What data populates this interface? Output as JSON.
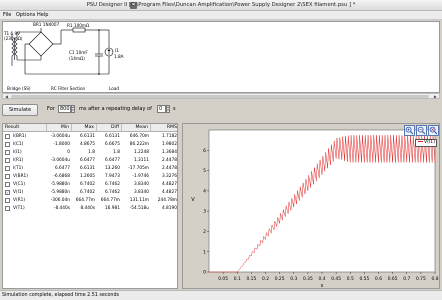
{
  "window": {
    "title": "PSU Designer II  [C:\\Program Files\\Duncan Amplification\\Power Supply Designer 2\\SEX filament.psu ]  *",
    "app_icon": "psud-app-icon"
  },
  "menu": {
    "items": [
      "File",
      "Options",
      "Help"
    ]
  },
  "schematic": {
    "labels": {
      "br": "BR1 1N4007",
      "t1": "T1 6.9V",
      "t1_r": "(230mΩ)",
      "r1": "R1 100mΩ",
      "c1": "C1 10mF",
      "c1_esr": "(14mΩ)",
      "i1": "I1",
      "i1_val": "1.8A",
      "bridge": "Bridge (SS)",
      "rc": "RC Filter Section",
      "load": "Load"
    }
  },
  "controls": {
    "simulate_label": "Simulate",
    "for_label": "For",
    "duration": "800",
    "ms_label": "ms  after a repeating delay of",
    "delay": "0",
    "s_label": "s"
  },
  "results": {
    "headers": [
      "Result",
      "Min",
      "Max",
      "Diff",
      "Mean",
      "RMS"
    ],
    "rows": [
      {
        "checked": false,
        "name": "I(BR1)",
        "min": "-3.0604u",
        "max": "6.6131",
        "diff": "6.6131",
        "mean": "646.70m",
        "rms": "1.7182"
      },
      {
        "checked": false,
        "name": "I(C1)",
        "min": "-1.8000",
        "max": "4.8675",
        "diff": "6.6675",
        "mean": "86.222m",
        "rms": "1.9802"
      },
      {
        "checked": false,
        "name": "I(I1)",
        "min": "0",
        "max": "1.8",
        "diff": "1.8",
        "mean": "1.2248",
        "rms": "1.3684"
      },
      {
        "checked": false,
        "name": "I(R1)",
        "min": "-3.0604u",
        "max": "6.6477",
        "diff": "6.6477",
        "mean": "1.3111",
        "rms": "2.4478"
      },
      {
        "checked": false,
        "name": "I(T1)",
        "min": "6.6477",
        "max": "6.6131",
        "diff": "13.260",
        "mean": "-17.705m",
        "rms": "2.4478"
      },
      {
        "checked": false,
        "name": "V(BR1)",
        "min": "-6.6868",
        "max": "1.2605",
        "diff": "7.9473",
        "mean": "-1.9746",
        "rms": "3.3276"
      },
      {
        "checked": false,
        "name": "V(C1)",
        "min": "-5.9880n",
        "max": "6.7402",
        "diff": "6.7462",
        "mean": "3.8340",
        "rms": "4.4827"
      },
      {
        "checked": true,
        "name": "V(I1)",
        "min": "-5.9880n",
        "max": "6.7402",
        "diff": "6.7462",
        "mean": "3.8340",
        "rms": "4.4827"
      },
      {
        "checked": false,
        "name": "V(R1)",
        "min": "-306.04n",
        "max": "664.77m",
        "diff": "664.77m",
        "mean": "131.11m",
        "rms": "244.78m"
      },
      {
        "checked": false,
        "name": "V(T1)",
        "min": "-8.440s",
        "max": "8.440s",
        "diff": "16.981",
        "mean": "-54.518u",
        "rms": "4.8190"
      }
    ]
  },
  "chart_data": {
    "type": "line",
    "title": "",
    "xlabel": "s",
    "ylabel": "V",
    "xlim": [
      0,
      0.8
    ],
    "ylim": [
      0,
      7
    ],
    "x_ticks": [
      "0.05",
      "0.1",
      "0.15",
      "0.2",
      "0.25",
      "0.3",
      "0.35",
      "0.4",
      "0.45",
      "0.5",
      "0.55",
      "0.6",
      "0.65",
      "0.7",
      "0.75",
      "0.8"
    ],
    "y_ticks": [
      "0",
      "1",
      "2",
      "3",
      "4",
      "5",
      "6"
    ],
    "series": [
      {
        "name": "V(I1)",
        "color": "#e02020",
        "envelope": {
          "x": [
            0,
            0.1,
            0.45,
            0.5,
            0.8
          ],
          "upper": [
            0,
            0,
            6.6,
            6.74,
            6.74
          ],
          "lower": [
            0,
            0,
            5.6,
            5.4,
            5.4
          ]
        }
      }
    ],
    "legend": "top-right",
    "grid": false
  },
  "graph": {
    "zoom_icons": [
      "zoom-in-icon",
      "zoom-out-icon",
      "zoom-reset-icon"
    ],
    "legend_label": "V(I1)"
  },
  "status": {
    "text": "Simulation complete, elapsed time 2.51 seconds"
  }
}
